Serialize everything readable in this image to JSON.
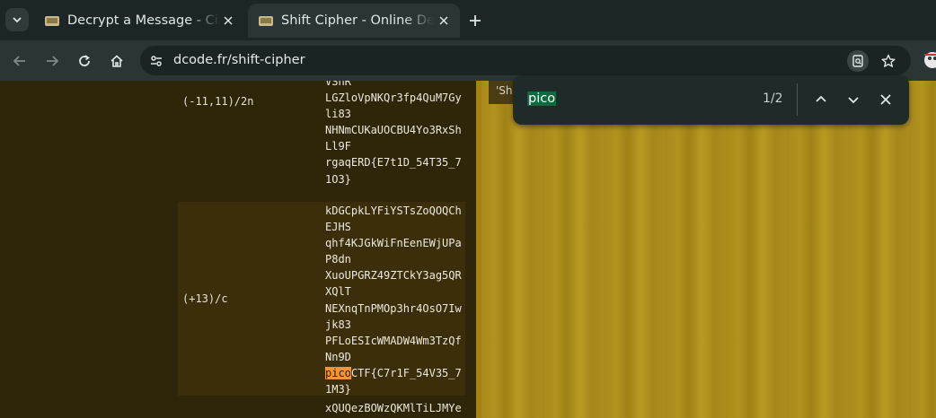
{
  "tabs": [
    {
      "title": "Decrypt a Message - Ciph",
      "active": false
    },
    {
      "title": "Shift Cipher - Online Dec",
      "active": true
    }
  ],
  "toolbar": {
    "url": "dcode.fr/shift-cipher"
  },
  "results": [
    {
      "shift": "(-11,11)/2n",
      "lines": [
        "VSnR",
        "LGZloVpNKQr3fp4QuM7Gy",
        "li83",
        "NHNmCUKaUOCBU4Yo3RxSh",
        "Ll9F",
        "rgaqERD{E7t1D_54T35_7",
        "1O3}"
      ]
    },
    {
      "shift": "(+13)/c",
      "lines": [
        "kDGCpkLYFiYSTsZoQOQCh",
        "EJHS",
        "qhf4KJGkWiFnEenEWjUPa",
        "P8dn",
        "XuoUPGRZ49ZTCkY3ag5QR",
        "XQlT",
        "NEXnqTnPMOp3hr4OsO7Iw",
        "jk83",
        "PFLoESIcWMADW4Wm3TzQf",
        "Nn9D"
      ],
      "highlight_match": "pico",
      "highlight_rest": "CTF{C7r1F_54V35_7",
      "last_line": "1M3}"
    },
    {
      "shift": "",
      "lines": [
        "xQUQezBOWzQKMlTiLJMYe"
      ]
    }
  ],
  "snippet_text": "'Sh",
  "find": {
    "query": "pico",
    "count": "1/2"
  }
}
